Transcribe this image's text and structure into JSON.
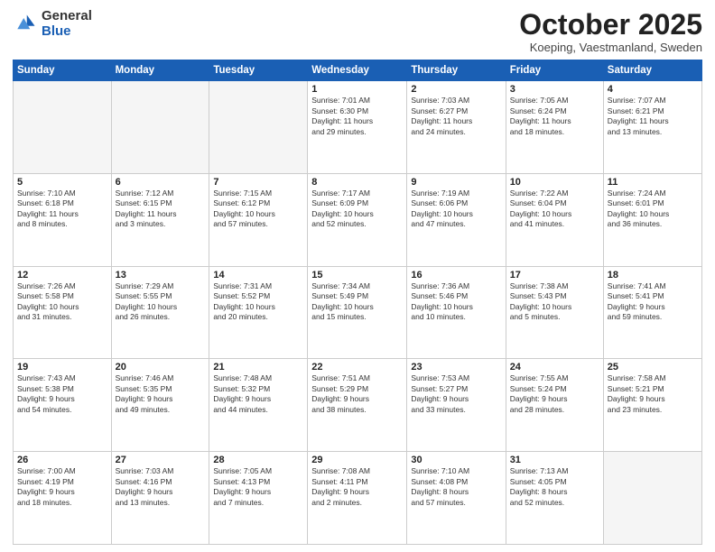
{
  "header": {
    "logo_general": "General",
    "logo_blue": "Blue",
    "month_title": "October 2025",
    "subtitle": "Koeping, Vaestmanland, Sweden"
  },
  "days_of_week": [
    "Sunday",
    "Monday",
    "Tuesday",
    "Wednesday",
    "Thursday",
    "Friday",
    "Saturday"
  ],
  "weeks": [
    [
      {
        "num": "",
        "info": ""
      },
      {
        "num": "",
        "info": ""
      },
      {
        "num": "",
        "info": ""
      },
      {
        "num": "1",
        "info": "Sunrise: 7:01 AM\nSunset: 6:30 PM\nDaylight: 11 hours\nand 29 minutes."
      },
      {
        "num": "2",
        "info": "Sunrise: 7:03 AM\nSunset: 6:27 PM\nDaylight: 11 hours\nand 24 minutes."
      },
      {
        "num": "3",
        "info": "Sunrise: 7:05 AM\nSunset: 6:24 PM\nDaylight: 11 hours\nand 18 minutes."
      },
      {
        "num": "4",
        "info": "Sunrise: 7:07 AM\nSunset: 6:21 PM\nDaylight: 11 hours\nand 13 minutes."
      }
    ],
    [
      {
        "num": "5",
        "info": "Sunrise: 7:10 AM\nSunset: 6:18 PM\nDaylight: 11 hours\nand 8 minutes."
      },
      {
        "num": "6",
        "info": "Sunrise: 7:12 AM\nSunset: 6:15 PM\nDaylight: 11 hours\nand 3 minutes."
      },
      {
        "num": "7",
        "info": "Sunrise: 7:15 AM\nSunset: 6:12 PM\nDaylight: 10 hours\nand 57 minutes."
      },
      {
        "num": "8",
        "info": "Sunrise: 7:17 AM\nSunset: 6:09 PM\nDaylight: 10 hours\nand 52 minutes."
      },
      {
        "num": "9",
        "info": "Sunrise: 7:19 AM\nSunset: 6:06 PM\nDaylight: 10 hours\nand 47 minutes."
      },
      {
        "num": "10",
        "info": "Sunrise: 7:22 AM\nSunset: 6:04 PM\nDaylight: 10 hours\nand 41 minutes."
      },
      {
        "num": "11",
        "info": "Sunrise: 7:24 AM\nSunset: 6:01 PM\nDaylight: 10 hours\nand 36 minutes."
      }
    ],
    [
      {
        "num": "12",
        "info": "Sunrise: 7:26 AM\nSunset: 5:58 PM\nDaylight: 10 hours\nand 31 minutes."
      },
      {
        "num": "13",
        "info": "Sunrise: 7:29 AM\nSunset: 5:55 PM\nDaylight: 10 hours\nand 26 minutes."
      },
      {
        "num": "14",
        "info": "Sunrise: 7:31 AM\nSunset: 5:52 PM\nDaylight: 10 hours\nand 20 minutes."
      },
      {
        "num": "15",
        "info": "Sunrise: 7:34 AM\nSunset: 5:49 PM\nDaylight: 10 hours\nand 15 minutes."
      },
      {
        "num": "16",
        "info": "Sunrise: 7:36 AM\nSunset: 5:46 PM\nDaylight: 10 hours\nand 10 minutes."
      },
      {
        "num": "17",
        "info": "Sunrise: 7:38 AM\nSunset: 5:43 PM\nDaylight: 10 hours\nand 5 minutes."
      },
      {
        "num": "18",
        "info": "Sunrise: 7:41 AM\nSunset: 5:41 PM\nDaylight: 9 hours\nand 59 minutes."
      }
    ],
    [
      {
        "num": "19",
        "info": "Sunrise: 7:43 AM\nSunset: 5:38 PM\nDaylight: 9 hours\nand 54 minutes."
      },
      {
        "num": "20",
        "info": "Sunrise: 7:46 AM\nSunset: 5:35 PM\nDaylight: 9 hours\nand 49 minutes."
      },
      {
        "num": "21",
        "info": "Sunrise: 7:48 AM\nSunset: 5:32 PM\nDaylight: 9 hours\nand 44 minutes."
      },
      {
        "num": "22",
        "info": "Sunrise: 7:51 AM\nSunset: 5:29 PM\nDaylight: 9 hours\nand 38 minutes."
      },
      {
        "num": "23",
        "info": "Sunrise: 7:53 AM\nSunset: 5:27 PM\nDaylight: 9 hours\nand 33 minutes."
      },
      {
        "num": "24",
        "info": "Sunrise: 7:55 AM\nSunset: 5:24 PM\nDaylight: 9 hours\nand 28 minutes."
      },
      {
        "num": "25",
        "info": "Sunrise: 7:58 AM\nSunset: 5:21 PM\nDaylight: 9 hours\nand 23 minutes."
      }
    ],
    [
      {
        "num": "26",
        "info": "Sunrise: 7:00 AM\nSunset: 4:19 PM\nDaylight: 9 hours\nand 18 minutes."
      },
      {
        "num": "27",
        "info": "Sunrise: 7:03 AM\nSunset: 4:16 PM\nDaylight: 9 hours\nand 13 minutes."
      },
      {
        "num": "28",
        "info": "Sunrise: 7:05 AM\nSunset: 4:13 PM\nDaylight: 9 hours\nand 7 minutes."
      },
      {
        "num": "29",
        "info": "Sunrise: 7:08 AM\nSunset: 4:11 PM\nDaylight: 9 hours\nand 2 minutes."
      },
      {
        "num": "30",
        "info": "Sunrise: 7:10 AM\nSunset: 4:08 PM\nDaylight: 8 hours\nand 57 minutes."
      },
      {
        "num": "31",
        "info": "Sunrise: 7:13 AM\nSunset: 4:05 PM\nDaylight: 8 hours\nand 52 minutes."
      },
      {
        "num": "",
        "info": ""
      }
    ]
  ]
}
